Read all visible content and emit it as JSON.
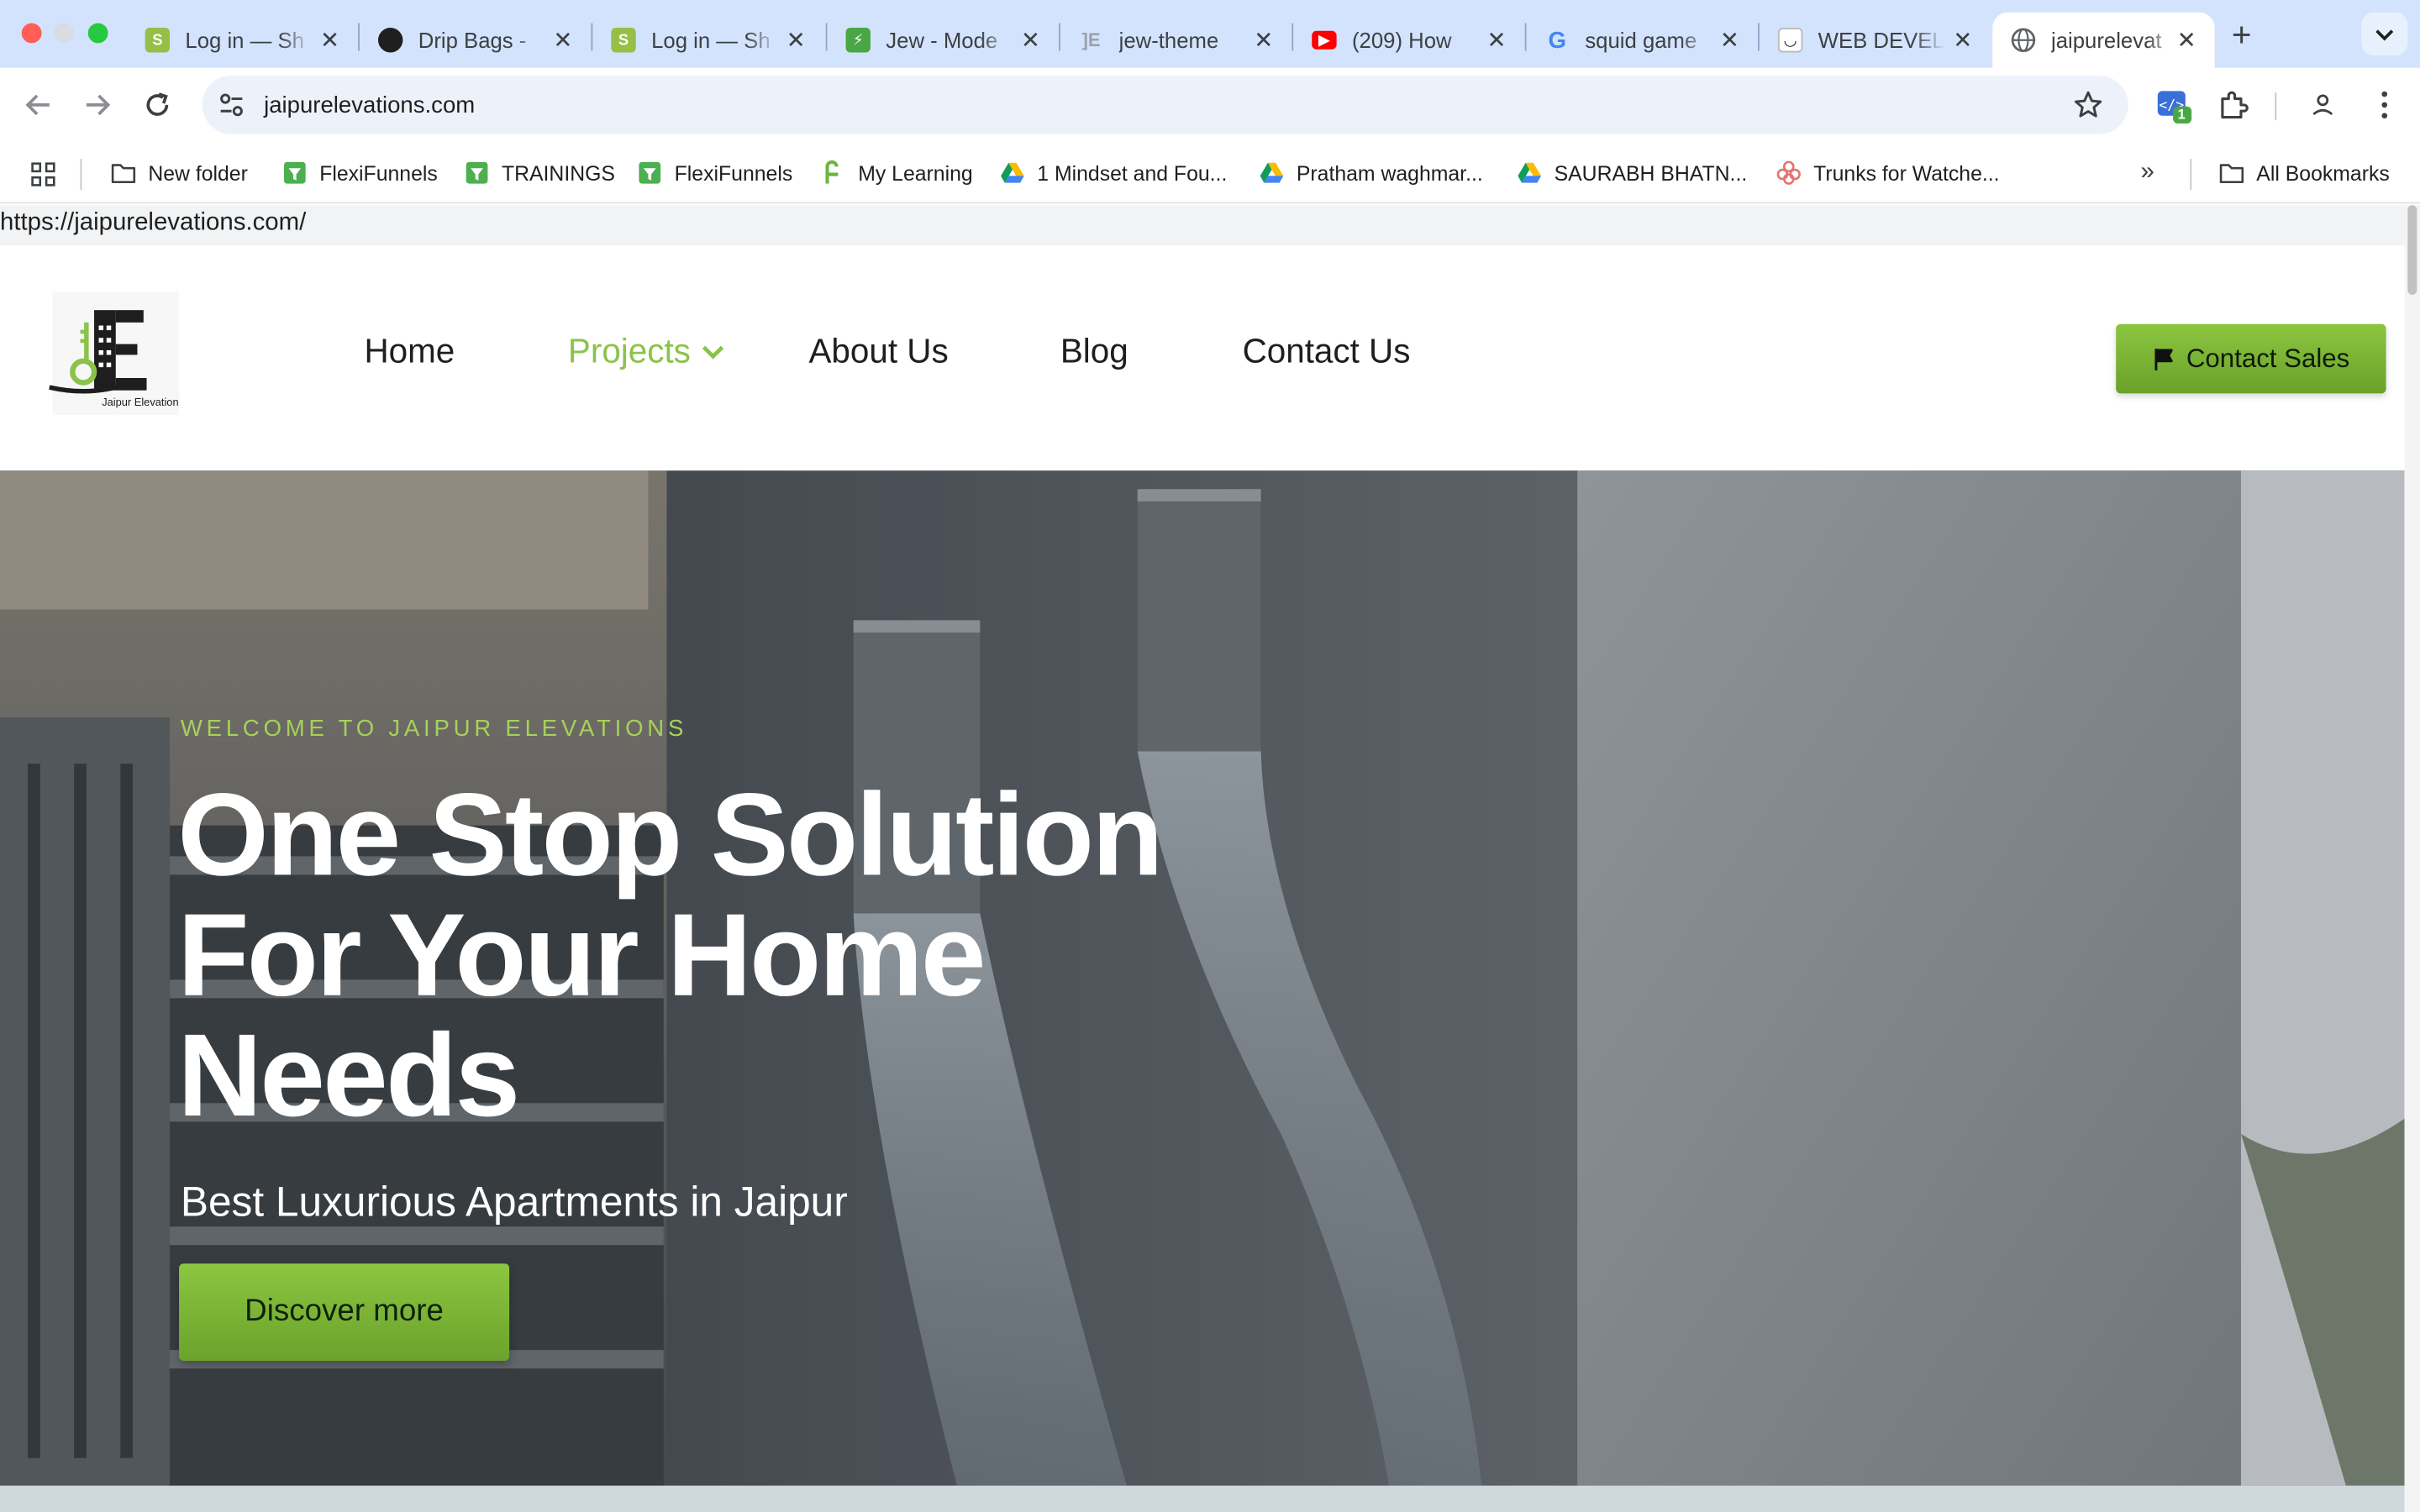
{
  "browser": {
    "tabs": [
      {
        "title": "Log in — Sh",
        "icon": "shopify-icon",
        "color": "#95bf47"
      },
      {
        "title": "Drip Bags - ",
        "icon": "dark-circle-icon",
        "color": "#1f1f1f"
      },
      {
        "title": "Log in — Sh",
        "icon": "shopify-icon",
        "color": "#95bf47"
      },
      {
        "title": "Jew - Mode",
        "icon": "green-bolt-icon",
        "color": "#49a844"
      },
      {
        "title": "jew-theme",
        "icon": "doc-icon",
        "color": "#9aa0a6"
      },
      {
        "title": "(209) How",
        "icon": "youtube-icon",
        "color": "#ff0000"
      },
      {
        "title": "squid game",
        "icon": "google-icon",
        "color": "#4285f4"
      },
      {
        "title": "WEB DEVEL",
        "icon": "site-icon",
        "color": "#202124"
      },
      {
        "title": "jaipurelevat",
        "icon": "globe-icon",
        "color": "#5f6368",
        "active": true
      }
    ],
    "url": "jaipurelevations.com",
    "status_url": "https://jaipurelevations.com/",
    "extension_badge": "1",
    "bookmarks": [
      {
        "label": "New folder",
        "icon": "folder-icon"
      },
      {
        "label": "FlexiFunnels",
        "icon": "flexifunnels-icon"
      },
      {
        "label": "TRAININGS",
        "icon": "flexifunnels-icon"
      },
      {
        "label": "FlexiFunnels",
        "icon": "flexifunnels-icon"
      },
      {
        "label": "My Learning",
        "icon": "learning-icon"
      },
      {
        "label": "1 Mindset and Fou...",
        "icon": "drive-icon"
      },
      {
        "label": "Pratham waghmar...",
        "icon": "drive-icon"
      },
      {
        "label": "SAURABH BHATN...",
        "icon": "drive-icon"
      },
      {
        "label": "Trunks for Watche...",
        "icon": "flower-icon"
      }
    ],
    "all_bookmarks_label": "All Bookmarks"
  },
  "site": {
    "logo_caption": "Jaipur Elevation",
    "nav": {
      "home": "Home",
      "projects": "Projects",
      "about": "About Us",
      "blog": "Blog",
      "contact": "Contact Us"
    },
    "cta_label": "Contact Sales",
    "hero": {
      "eyebrow": "WELCOME TO JAIPUR ELEVATIONS",
      "title": "One Stop Solution For Your Home Needs",
      "subtitle": "Best Luxurious Apartments in Jaipur",
      "button": "Discover more"
    }
  },
  "colors": {
    "accent_green": "#8bc34a",
    "tabstrip": "#d3e3fd"
  }
}
